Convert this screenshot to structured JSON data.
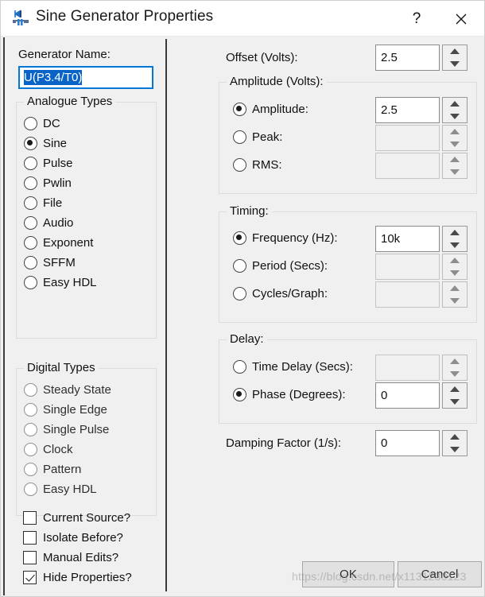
{
  "window": {
    "title": "Sine Generator Properties",
    "icon": "generator-icon",
    "help_label": "?",
    "close_label": "✕"
  },
  "left": {
    "generator_name_label": "Generator Name:",
    "generator_name_value": "U(P3.4/T0)",
    "analogue_types": {
      "title": "Analogue Types",
      "selected": "Sine",
      "items": [
        {
          "label": "DC",
          "checked": false
        },
        {
          "label": "Sine",
          "checked": true
        },
        {
          "label": "Pulse",
          "checked": false
        },
        {
          "label": "Pwlin",
          "checked": false
        },
        {
          "label": "File",
          "checked": false
        },
        {
          "label": "Audio",
          "checked": false
        },
        {
          "label": "Exponent",
          "checked": false
        },
        {
          "label": "SFFM",
          "checked": false
        },
        {
          "label": "Easy HDL",
          "checked": false
        }
      ]
    },
    "digital_types": {
      "title": "Digital Types",
      "selected": null,
      "items": [
        {
          "label": "Steady State",
          "checked": false
        },
        {
          "label": "Single Edge",
          "checked": false
        },
        {
          "label": "Single Pulse",
          "checked": false
        },
        {
          "label": "Clock",
          "checked": false
        },
        {
          "label": "Pattern",
          "checked": false
        },
        {
          "label": "Easy HDL",
          "checked": false
        }
      ]
    },
    "options": [
      {
        "label": "Current Source?",
        "checked": false
      },
      {
        "label": "Isolate Before?",
        "checked": false
      },
      {
        "label": "Manual Edits?",
        "checked": false
      },
      {
        "label": "Hide Properties?",
        "checked": true
      }
    ]
  },
  "right": {
    "offset": {
      "label": "Offset (Volts):",
      "value": "2.5"
    },
    "amplitude_group": {
      "title": "Amplitude (Volts):",
      "rows": [
        {
          "label": "Amplitude:",
          "checked": true,
          "value": "2.5",
          "enabled": true
        },
        {
          "label": "Peak:",
          "checked": false,
          "value": "",
          "enabled": false
        },
        {
          "label": "RMS:",
          "checked": false,
          "value": "",
          "enabled": false
        }
      ]
    },
    "timing_group": {
      "title": "Timing:",
      "rows": [
        {
          "label": "Frequency (Hz):",
          "checked": true,
          "value": "10k",
          "enabled": true
        },
        {
          "label": "Period (Secs):",
          "checked": false,
          "value": "",
          "enabled": false
        },
        {
          "label": "Cycles/Graph:",
          "checked": false,
          "value": "",
          "enabled": false
        }
      ]
    },
    "delay_group": {
      "title": "Delay:",
      "rows": [
        {
          "label": "Time Delay (Secs):",
          "checked": false,
          "value": "",
          "enabled": false
        },
        {
          "label": "Phase (Degrees):",
          "checked": true,
          "value": "0",
          "enabled": true
        }
      ]
    },
    "damping": {
      "label": "Damping Factor (1/s):",
      "value": "0"
    }
  },
  "buttons": {
    "ok": "OK",
    "cancel": "Cancel"
  },
  "watermark": "https://blog.csdn.net/x1131230123",
  "colors": {
    "accent": "#0078d7",
    "selection": "#0a64c8",
    "window_bg": "#f0f0f0",
    "titlebar_bg": "#ffffff",
    "divider": "#3a3a3a"
  }
}
